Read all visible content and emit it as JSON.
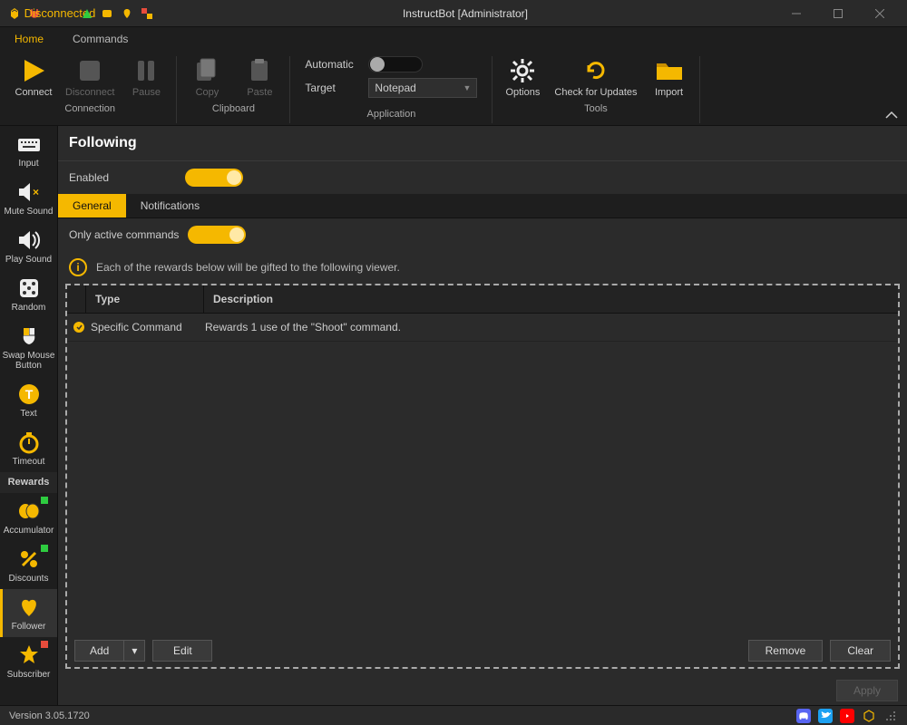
{
  "titlebar": {
    "status": "Disconnected",
    "title": "InstructBot [Administrator]"
  },
  "menu": {
    "home": "Home",
    "commands": "Commands"
  },
  "ribbon": {
    "connect": "Connect",
    "disconnect": "Disconnect",
    "pause": "Pause",
    "copy": "Copy",
    "paste": "Paste",
    "automatic": "Automatic",
    "target": "Target",
    "target_value": "Notepad",
    "options": "Options",
    "check_updates": "Check for Updates",
    "import": "Import",
    "groups": {
      "connection": "Connection",
      "clipboard": "Clipboard",
      "application": "Application",
      "tools": "Tools"
    }
  },
  "vnav": {
    "input": "Input",
    "mute": "Mute Sound",
    "play": "Play Sound",
    "random": "Random",
    "swap": "Swap Mouse Button",
    "text": "Text",
    "timeout": "Timeout",
    "rewards": "Rewards",
    "accum": "Accumulator",
    "discounts": "Discounts",
    "follower": "Follower",
    "subscriber": "Subscriber"
  },
  "content": {
    "title": "Following",
    "enabled": "Enabled",
    "only_active": "Only active commands",
    "tabs": {
      "general": "General",
      "notifications": "Notifications"
    },
    "info": "Each of the rewards below will be gifted to the following viewer.",
    "headers": {
      "type": "Type",
      "desc": "Description"
    },
    "rows": [
      {
        "type": "Specific Command",
        "desc": "Rewards 1 use of the \"Shoot\" command."
      }
    ],
    "buttons": {
      "add": "Add",
      "edit": "Edit",
      "remove": "Remove",
      "clear": "Clear",
      "apply": "Apply"
    }
  },
  "status": {
    "version": "Version 3.05.1720"
  }
}
